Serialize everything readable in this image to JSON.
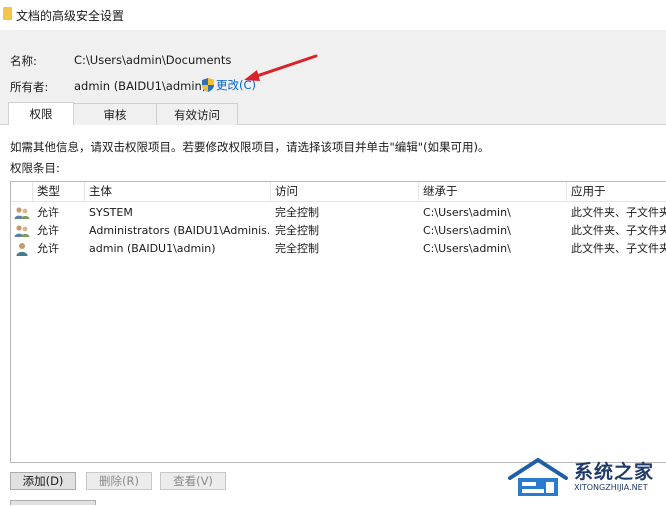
{
  "window": {
    "title": "文档的高级安全设置"
  },
  "fields": {
    "name_label": "名称:",
    "name_value": "C:\\Users\\admin\\Documents",
    "owner_label": "所有者:",
    "owner_value": "admin (BAIDU1\\admin)",
    "change_link": "更改(C)"
  },
  "tabs": [
    {
      "label": "权限",
      "active": true
    },
    {
      "label": "审核",
      "active": false
    },
    {
      "label": "有效访问",
      "active": false
    }
  ],
  "info_text": "如需其他信息，请双击权限项目。若要修改权限项目，请选择该项目并单击\"编辑\"(如果可用)。",
  "permissions_label": "权限条目:",
  "table": {
    "columns": [
      "类型",
      "主体",
      "访问",
      "继承于",
      "应用于"
    ],
    "rows": [
      {
        "icon": "users-group-icon",
        "type": "允许",
        "principal": "SYSTEM",
        "access": "完全控制",
        "inherited": "C:\\Users\\admin\\",
        "applies": "此文件夹、子文件夹"
      },
      {
        "icon": "users-group-icon",
        "type": "允许",
        "principal": "Administrators (BAIDU1\\Adminis...",
        "access": "完全控制",
        "inherited": "C:\\Users\\admin\\",
        "applies": "此文件夹、子文件夹"
      },
      {
        "icon": "user-icon",
        "type": "允许",
        "principal": "admin (BAIDU1\\admin)",
        "access": "完全控制",
        "inherited": "C:\\Users\\admin\\",
        "applies": "此文件夹、子文件夹"
      }
    ]
  },
  "buttons": {
    "add": "添加(D)",
    "remove": "删除(R)",
    "view": "查看(V)"
  },
  "watermark": {
    "brand": "系统之家",
    "url": "XITONGZHIJIA.NET"
  },
  "colors": {
    "link": "#0066cc",
    "annotation_arrow": "#d9232a",
    "folder": "#f3c64b"
  }
}
